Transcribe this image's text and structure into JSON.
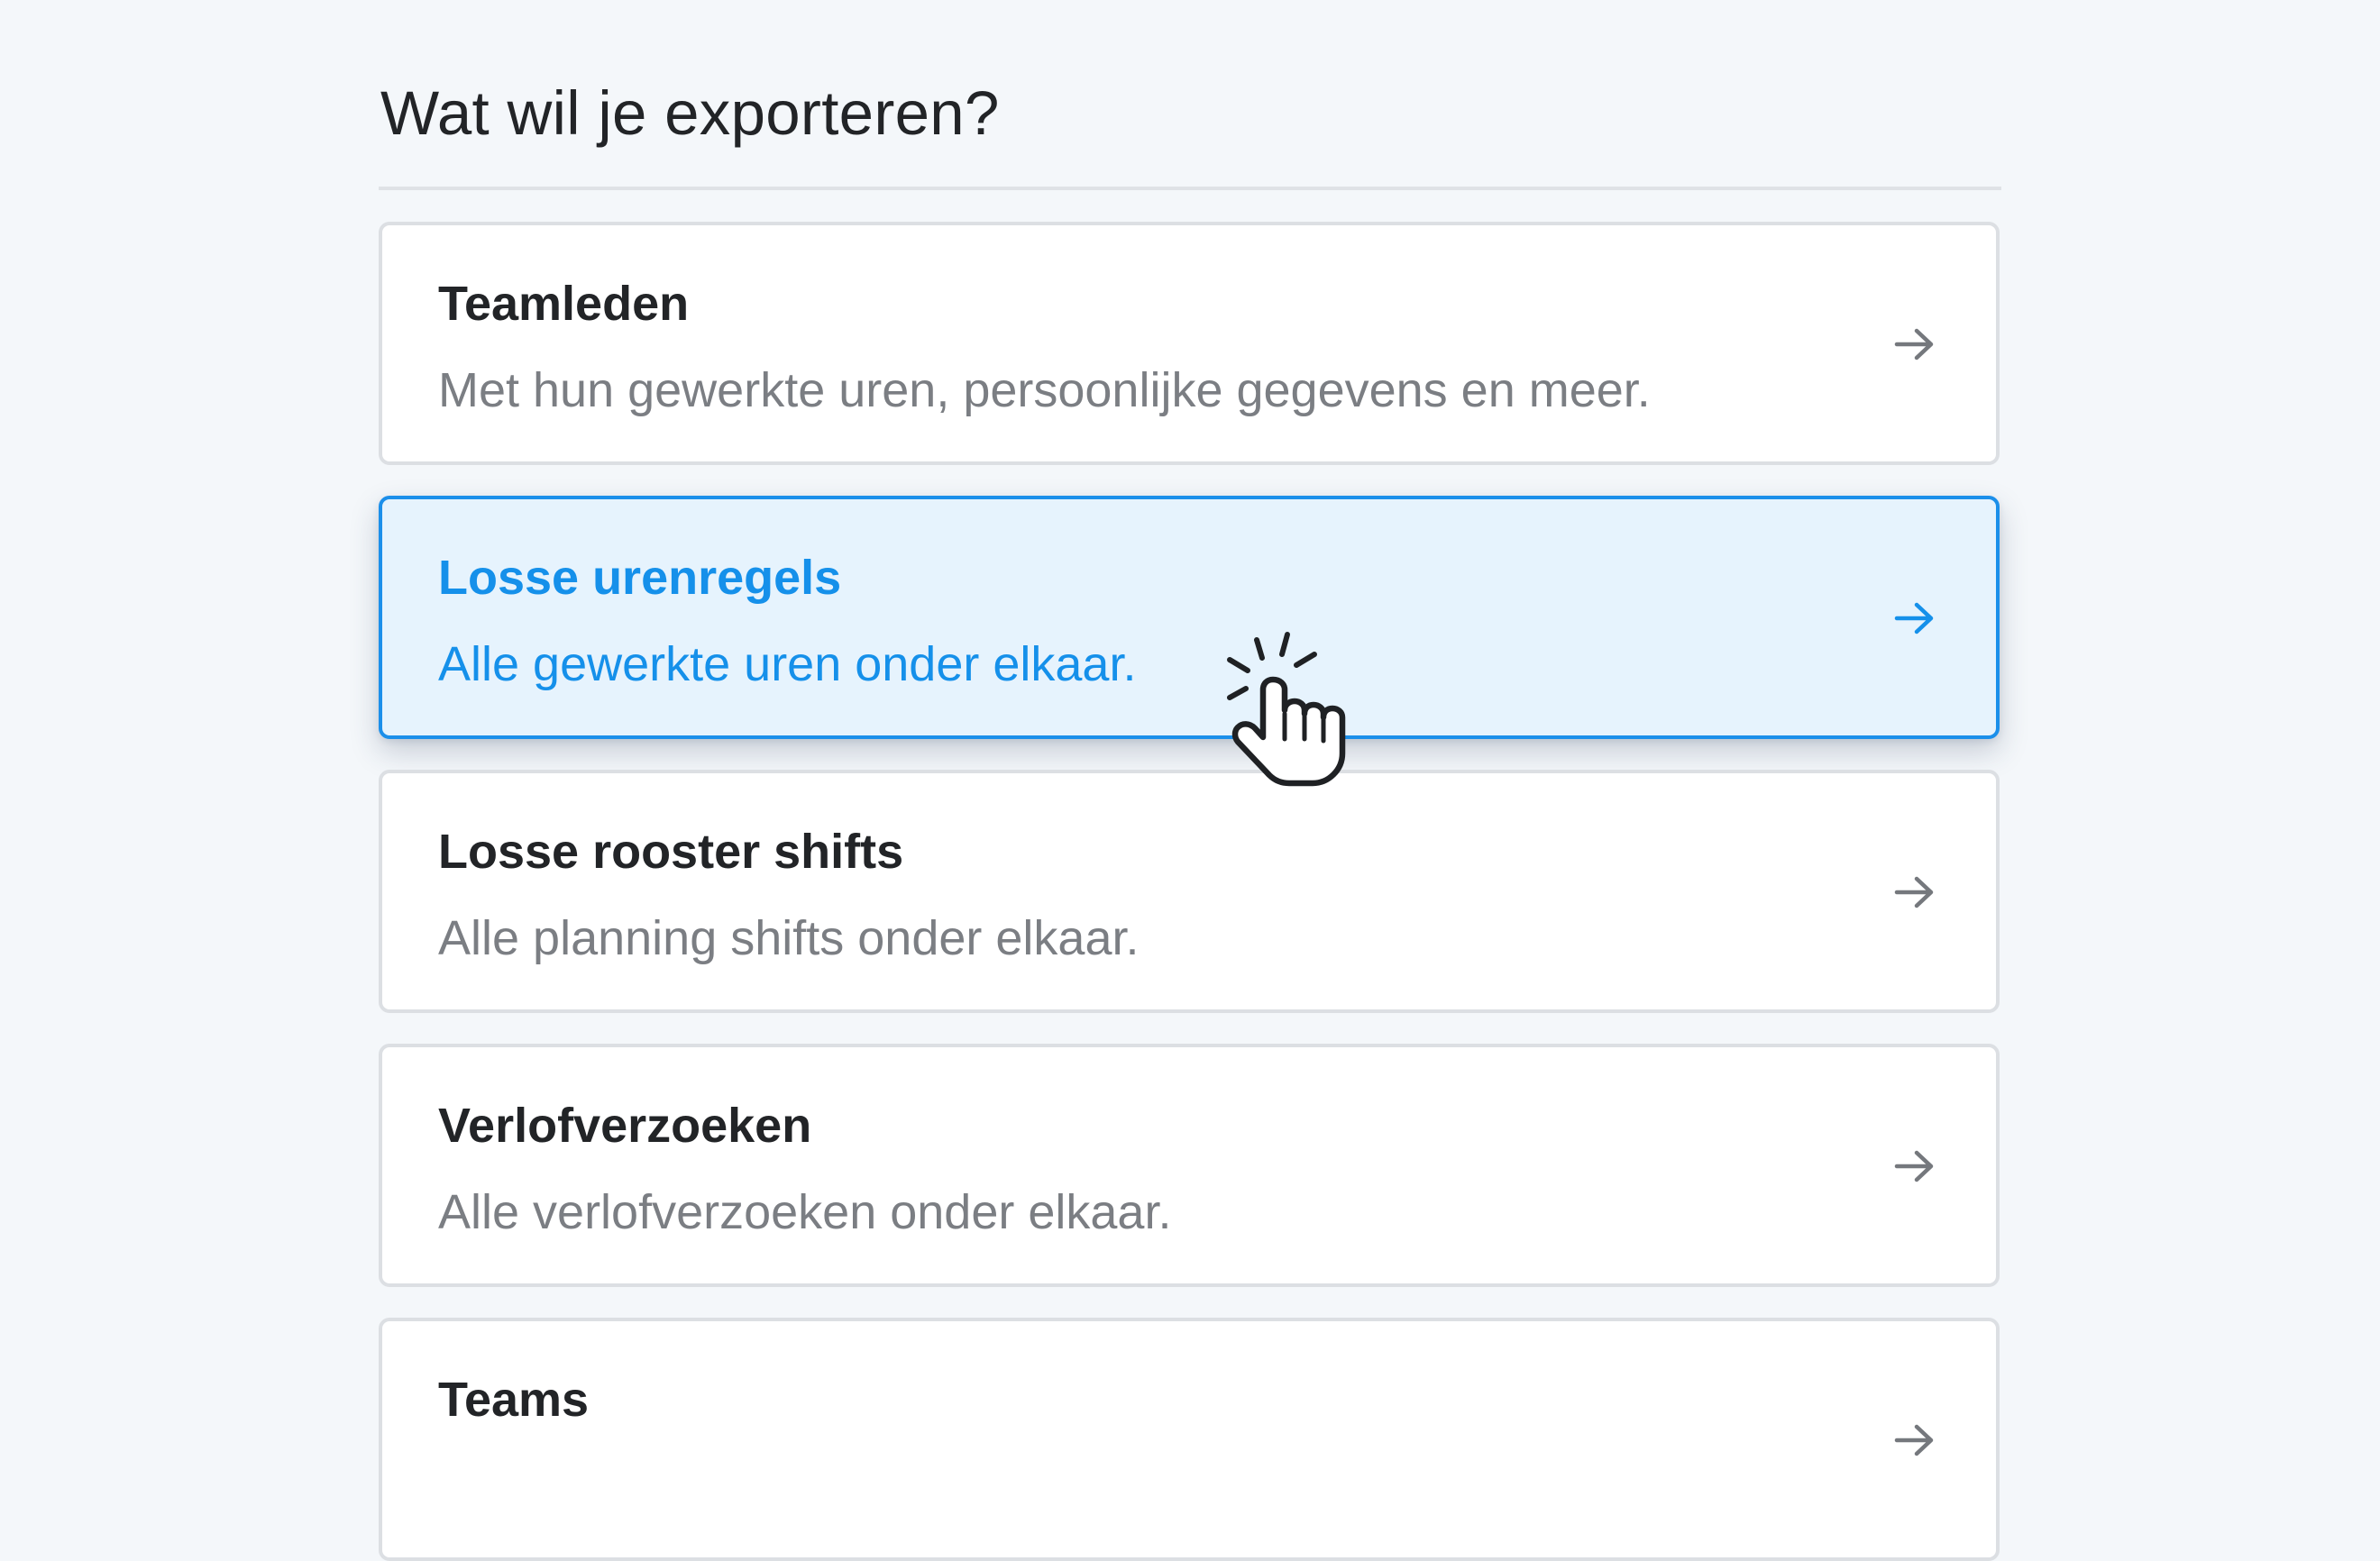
{
  "header": {
    "title": "Wat wil je exporteren?"
  },
  "options": [
    {
      "title": "Teamleden",
      "description": "Met hun gewerkte uren, persoonlijke gegevens en meer.",
      "selected": false
    },
    {
      "title": "Losse urenregels",
      "description": "Alle gewerkte uren onder elkaar.",
      "selected": true
    },
    {
      "title": "Losse rooster shifts",
      "description": "Alle planning shifts onder elkaar.",
      "selected": false
    },
    {
      "title": "Verlofverzoeken",
      "description": "Alle verlofverzoeken onder elkaar.",
      "selected": false
    },
    {
      "title": "Teams",
      "description": "",
      "selected": false
    }
  ],
  "icons": {
    "option_arrow": "arrow-right-icon",
    "pointer": "hand-pointer-click-icon"
  },
  "colors": {
    "accent": "#1590ea",
    "selected_background": "#e6f3fd",
    "text_primary": "#222427",
    "text_secondary": "#7b7e83",
    "page_background": "#f4f7fa"
  }
}
